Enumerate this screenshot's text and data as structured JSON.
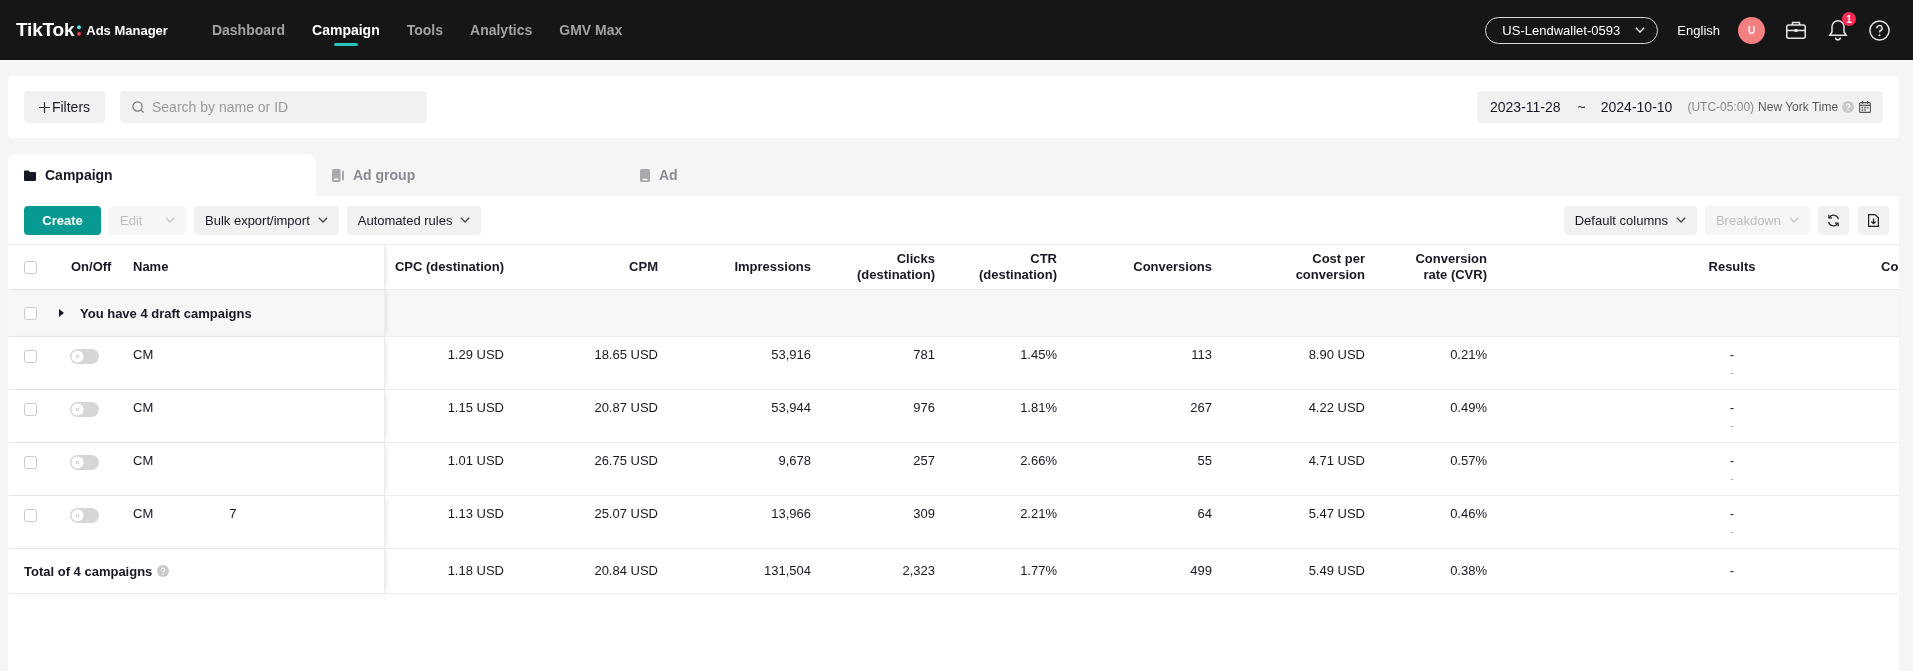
{
  "top_bar": {
    "logo": {
      "brand": "TikTok",
      "product": "Ads Manager"
    },
    "nav": [
      {
        "label": "Dashboard",
        "selected": false
      },
      {
        "label": "Campaign",
        "selected": true
      },
      {
        "label": "Tools",
        "selected": false
      },
      {
        "label": "Analytics",
        "selected": false
      },
      {
        "label": "GMV Max",
        "selected": false
      }
    ],
    "account": "US-Lendwallet-0593",
    "language": "English",
    "avatar": "U",
    "notifications": "1"
  },
  "filter_bar": {
    "filters_button": "Filters",
    "search": {
      "placeholder": "Search by name or ID"
    },
    "date_range": {
      "start": "2023-11-28",
      "separator": "~",
      "end": "2024-10-10",
      "timezone_offset": "(UTC-05:00)",
      "timezone_name": "New York Time"
    }
  },
  "level_tabs": [
    {
      "label": "Campaign",
      "kind": "campaign",
      "selected": true
    },
    {
      "label": "Ad group",
      "kind": "ad_group",
      "selected": false
    },
    {
      "label": "Ad",
      "kind": "ad",
      "selected": false
    }
  ],
  "toolbar": {
    "left": [
      {
        "kind": "primary",
        "label": "Create",
        "disabled": false
      },
      {
        "kind": "dropdown",
        "label": "Edit",
        "disabled": true
      },
      {
        "kind": "dropdown",
        "label": "Bulk export/import",
        "disabled": false
      },
      {
        "kind": "dropdown",
        "label": "Automated rules",
        "disabled": false
      }
    ],
    "right": [
      {
        "kind": "dropdown",
        "label": "Default columns",
        "disabled": false
      },
      {
        "kind": "dropdown",
        "label": "Breakdown",
        "disabled": true
      },
      {
        "kind": "refresh",
        "disabled": false
      },
      {
        "kind": "export",
        "disabled": false
      }
    ]
  },
  "table": {
    "select_all_checked": false,
    "frozen_columns": [
      "On/Off",
      "Name"
    ],
    "columns": [
      {
        "label": "CPC (destination)",
        "kind": "metric"
      },
      {
        "label": "CPM",
        "kind": "metric"
      },
      {
        "label": "Impressions",
        "kind": "metric"
      },
      {
        "label": "Clicks (destination)",
        "kind": "metric"
      },
      {
        "label": "CTR (destination)",
        "kind": "metric"
      },
      {
        "label": "Conversions",
        "kind": "metric"
      },
      {
        "label": "Cost per conversion",
        "kind": "metric"
      },
      {
        "label": "Conversion rate (CVR)",
        "kind": "metric"
      },
      {
        "label": "Results",
        "kind": "results"
      },
      {
        "label": "Co",
        "kind": "partial"
      }
    ],
    "draft_group": {
      "label": "You have 4 draft campaigns",
      "checked": false,
      "expanded": false
    },
    "rows": [
      {
        "checked": false,
        "on": false,
        "name": "CM",
        "values": [
          "1.29 USD",
          "18.65 USD",
          "53,916",
          "781",
          "1.45%",
          "113",
          "8.90 USD",
          "0.21%"
        ],
        "results": {
          "main": "-",
          "sub": "-"
        }
      },
      {
        "checked": false,
        "on": false,
        "name": "CM",
        "values": [
          "1.15 USD",
          "20.87 USD",
          "53,944",
          "976",
          "1.81%",
          "267",
          "4.22 USD",
          "0.49%"
        ],
        "results": {
          "main": "-",
          "sub": "-"
        }
      },
      {
        "checked": false,
        "on": false,
        "name": "CM",
        "values": [
          "1.01 USD",
          "26.75 USD",
          "9,678",
          "257",
          "2.66%",
          "55",
          "4.71 USD",
          "0.57%"
        ],
        "results": {
          "main": "-",
          "sub": "-"
        }
      },
      {
        "checked": false,
        "on": false,
        "name": "CM",
        "name_end": "7",
        "values": [
          "1.13 USD",
          "25.07 USD",
          "13,966",
          "309",
          "2.21%",
          "64",
          "5.47 USD",
          "0.46%"
        ],
        "results": {
          "main": "-",
          "sub": "-"
        }
      }
    ],
    "total": {
      "label": "Total of 4 campaigns",
      "values": [
        "1.18 USD",
        "20.84 USD",
        "131,504",
        "2,323",
        "1.77%",
        "499",
        "5.49 USD",
        "0.38%"
      ],
      "results": {
        "main": "-"
      }
    }
  }
}
